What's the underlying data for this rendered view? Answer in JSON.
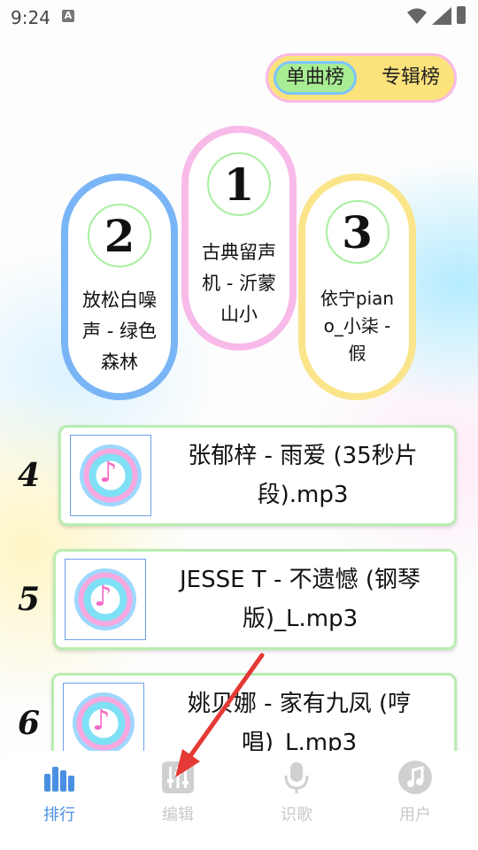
{
  "status_bar": {
    "time": "9:24",
    "notification_icon": "A"
  },
  "chart_toggle": {
    "active": "单曲榜",
    "inactive": "专辑榜"
  },
  "podium": [
    {
      "rank": "1",
      "title": "古典留声机 - 沂蒙山小"
    },
    {
      "rank": "2",
      "title": "放松白噪声 - 绿色森林"
    },
    {
      "rank": "3",
      "title": "依宁piano_小柒 - 假"
    }
  ],
  "list": [
    {
      "rank": "4",
      "title": "张郁梓 - 雨爱 (35秒片段).mp3"
    },
    {
      "rank": "5",
      "title": "JESSE T - 不遗憾 (钢琴版)_L.mp3"
    },
    {
      "rank": "6",
      "title": "姚贝娜 - 家有九凤 (哼唱)_L.mp3"
    }
  ],
  "bottom_nav": [
    {
      "label": "排行",
      "icon": "bar-chart-icon",
      "active": true
    },
    {
      "label": "编辑",
      "icon": "equalizer-icon",
      "active": false
    },
    {
      "label": "识歌",
      "icon": "microphone-icon",
      "active": false
    },
    {
      "label": "用户",
      "icon": "music-note-icon",
      "active": false
    }
  ],
  "colors": {
    "accent": "#4a90e2",
    "inactive": "#c9c9c9",
    "arrow": "#e53935"
  }
}
